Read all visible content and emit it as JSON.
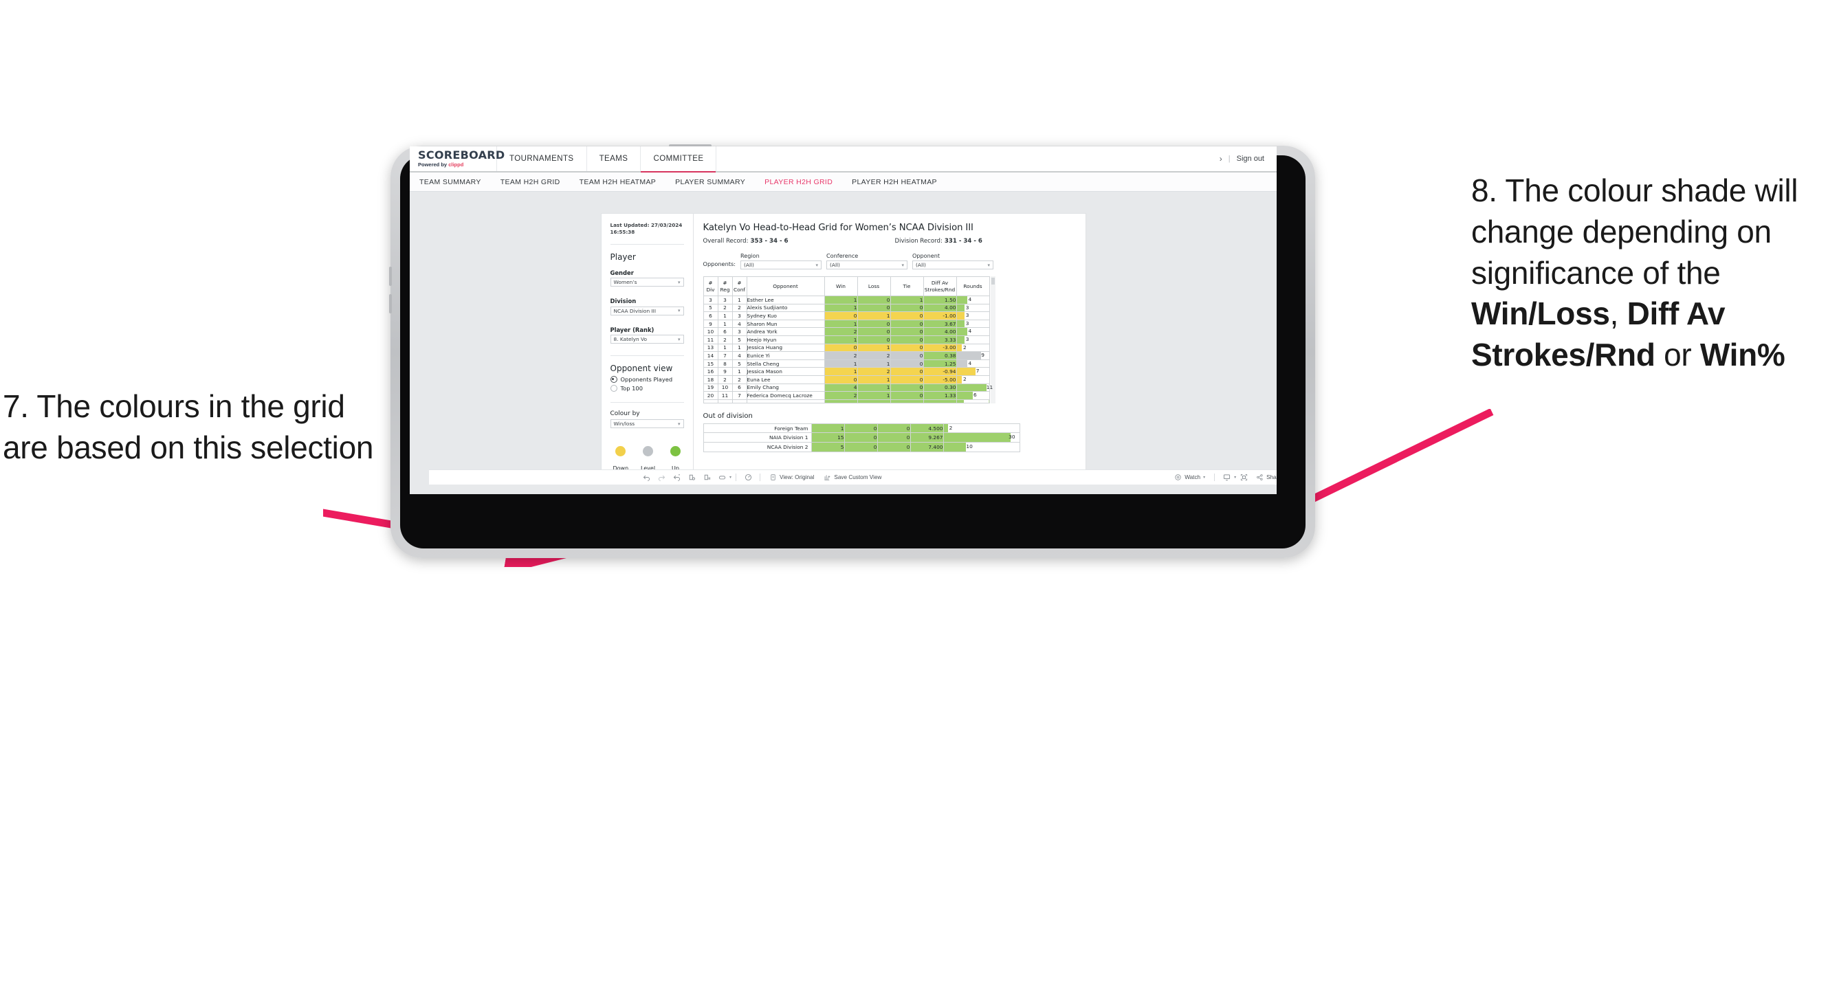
{
  "annotations": {
    "left": {
      "id": "7.",
      "text": "7. The colours in the grid are based on this selection"
    },
    "right": {
      "id": "8.",
      "line1": "8. The colour shade will change depending on significance of the ",
      "bold1": "Win/Loss",
      "mid1": ", ",
      "bold2": "Diff Av Strokes/Rnd",
      "mid2": " or ",
      "bold3": "Win%"
    },
    "arrow_color": "#EC1C5E"
  },
  "header": {
    "logo_word": "SCOREBOARD",
    "logo_powered": "Powered by ",
    "logo_brand": "clippd",
    "nav": [
      {
        "label": "TOURNAMENTS",
        "active": false
      },
      {
        "label": "TEAMS",
        "active": false
      },
      {
        "label": "COMMITTEE",
        "active": true
      }
    ],
    "chevron_icon": "›",
    "separator": "|",
    "sign_out": "Sign out"
  },
  "subnav": {
    "items": [
      {
        "label": "TEAM SUMMARY",
        "active": false
      },
      {
        "label": "TEAM H2H GRID",
        "active": false
      },
      {
        "label": "TEAM H2H HEATMAP",
        "active": false
      },
      {
        "label": "PLAYER SUMMARY",
        "active": false
      },
      {
        "label": "PLAYER H2H GRID",
        "active": true
      },
      {
        "label": "PLAYER H2H HEATMAP",
        "active": false
      }
    ],
    "active_color": "#E8386A"
  },
  "sidebar": {
    "last_updated_l1": "Last Updated: 27/03/2024",
    "last_updated_l2": "16:55:38",
    "player_heading": "Player",
    "fields": [
      {
        "label": "Gender",
        "value": "Women’s"
      },
      {
        "label": "Division",
        "value": "NCAA Division III"
      },
      {
        "label": "Player (Rank)",
        "value": "8. Katelyn Vo"
      }
    ],
    "opponent_view": {
      "heading": "Opponent view",
      "options": [
        {
          "label": "Opponents Played",
          "selected": true
        },
        {
          "label": "Top 100",
          "selected": false
        }
      ]
    },
    "colour_by": {
      "label": "Colour by",
      "value": "Win/loss"
    },
    "legend": [
      {
        "label": "Down",
        "color": "#F2D04B"
      },
      {
        "label": "Level",
        "color": "#BFC3C7"
      },
      {
        "label": "Up",
        "color": "#7DC242"
      }
    ],
    "caret_icon": "▾"
  },
  "main": {
    "title": "Katelyn Vo Head-to-Head Grid for Women’s NCAA Division III",
    "overall_record_label": "Overall Record:",
    "overall_record_value": "353 -  34 - 6",
    "division_record_label": "Division Record:",
    "division_record_value": "331 -  34 - 6",
    "opponents_label": "Opponents:",
    "filters": [
      {
        "label": "Region",
        "value": "(All)"
      },
      {
        "label": "Conference",
        "value": "(All)"
      },
      {
        "label": "Opponent",
        "value": "(All)"
      }
    ]
  },
  "chart_data": {
    "type": "table",
    "title": "Katelyn Vo Head-to-Head Grid for Women’s NCAA Division III",
    "columns": [
      "# Div",
      "# Reg",
      "# Conf",
      "Opponent",
      "Win",
      "Loss",
      "Tie",
      "Diff Av Strokes/Rnd",
      "Rounds"
    ],
    "column_headers_split": [
      {
        "l1": "#",
        "l2": "Div"
      },
      {
        "l1": "#",
        "l2": "Reg"
      },
      {
        "l1": "#",
        "l2": "Conf"
      },
      {
        "l1": "",
        "l2": "Opponent"
      },
      {
        "l1": "",
        "l2": "Win"
      },
      {
        "l1": "",
        "l2": "Loss"
      },
      {
        "l1": "",
        "l2": "Tie"
      },
      {
        "l1": "Diff Av",
        "l2": "Strokes/Rnd"
      },
      {
        "l1": "",
        "l2": "Rounds"
      }
    ],
    "rounds_max": 12,
    "colors": {
      "up": "#9ED06C",
      "down": "#F4D44F",
      "level": "#C9CCCF"
    },
    "rows": [
      {
        "div": "3",
        "reg": "3",
        "conf": "1",
        "opponent": "Esther Lee",
        "win": "1",
        "loss": "0",
        "tie": "1",
        "diff": "1.50",
        "rounds": "4",
        "rounds_val": 4,
        "status": "up"
      },
      {
        "div": "5",
        "reg": "2",
        "conf": "2",
        "opponent": "Alexis Sudjianto",
        "win": "1",
        "loss": "0",
        "tie": "0",
        "diff": "4.00",
        "rounds": "3",
        "rounds_val": 3,
        "status": "up"
      },
      {
        "div": "6",
        "reg": "1",
        "conf": "3",
        "opponent": "Sydney Kuo",
        "win": "0",
        "loss": "1",
        "tie": "0",
        "diff": "-1.00",
        "rounds": "3",
        "rounds_val": 3,
        "status": "down"
      },
      {
        "div": "9",
        "reg": "1",
        "conf": "4",
        "opponent": "Sharon Mun",
        "win": "1",
        "loss": "0",
        "tie": "0",
        "diff": "3.67",
        "rounds": "3",
        "rounds_val": 3,
        "status": "up"
      },
      {
        "div": "10",
        "reg": "6",
        "conf": "3",
        "opponent": "Andrea York",
        "win": "2",
        "loss": "0",
        "tie": "0",
        "diff": "4.00",
        "rounds": "4",
        "rounds_val": 4,
        "status": "up"
      },
      {
        "div": "11",
        "reg": "2",
        "conf": "5",
        "opponent": "Heejo Hyun",
        "win": "1",
        "loss": "0",
        "tie": "0",
        "diff": "3.33",
        "rounds": "3",
        "rounds_val": 3,
        "status": "up"
      },
      {
        "div": "13",
        "reg": "1",
        "conf": "1",
        "opponent": "Jessica Huang",
        "win": "0",
        "loss": "1",
        "tie": "0",
        "diff": "-3.00",
        "rounds": "2",
        "rounds_val": 2,
        "status": "down"
      },
      {
        "div": "14",
        "reg": "7",
        "conf": "4",
        "opponent": "Eunice Yi",
        "win": "2",
        "loss": "2",
        "tie": "0",
        "diff": "0.38",
        "rounds": "9",
        "rounds_val": 9,
        "status": "level",
        "diff_status": "up"
      },
      {
        "div": "15",
        "reg": "8",
        "conf": "5",
        "opponent": "Stella Cheng",
        "win": "1",
        "loss": "1",
        "tie": "0",
        "diff": "1.25",
        "rounds": "4",
        "rounds_val": 4,
        "status": "level",
        "diff_status": "up"
      },
      {
        "div": "16",
        "reg": "9",
        "conf": "1",
        "opponent": "Jessica Mason",
        "win": "1",
        "loss": "2",
        "tie": "0",
        "diff": "-0.94",
        "rounds": "7",
        "rounds_val": 7,
        "status": "down"
      },
      {
        "div": "18",
        "reg": "2",
        "conf": "2",
        "opponent": "Euna Lee",
        "win": "0",
        "loss": "1",
        "tie": "0",
        "diff": "-5.00",
        "rounds": "2",
        "rounds_val": 2,
        "status": "down"
      },
      {
        "div": "19",
        "reg": "10",
        "conf": "6",
        "opponent": "Emily Chang",
        "win": "4",
        "loss": "1",
        "tie": "0",
        "diff": "0.30",
        "rounds": "11",
        "rounds_val": 11,
        "status": "up"
      },
      {
        "div": "20",
        "reg": "11",
        "conf": "7",
        "opponent": "Federica Domecq Lacroze",
        "win": "2",
        "loss": "1",
        "tie": "0",
        "diff": "1.33",
        "rounds": "6",
        "rounds_val": 6,
        "status": "up"
      }
    ]
  },
  "out_of_division": {
    "title": "Out of division",
    "rounds_max": 34,
    "rows": [
      {
        "name": "Foreign Team",
        "win": "1",
        "loss": "0",
        "tie": "0",
        "diff": "4.500",
        "rounds": "2",
        "rounds_val": 2,
        "status": "up"
      },
      {
        "name": "NAIA Division 1",
        "win": "15",
        "loss": "0",
        "tie": "0",
        "diff": "9.267",
        "rounds": "30",
        "rounds_val": 30,
        "status": "up"
      },
      {
        "name": "NCAA Division 2",
        "win": "5",
        "loss": "0",
        "tie": "0",
        "diff": "7.400",
        "rounds": "10",
        "rounds_val": 10,
        "status": "up"
      }
    ]
  },
  "toolbar": {
    "icons": [
      {
        "name": "undo-icon",
        "glyph": "↶"
      },
      {
        "name": "redo-icon",
        "glyph": "↷"
      },
      {
        "name": "revert-icon",
        "glyph": "↺"
      },
      {
        "name": "refresh-data-icon",
        "glyph": "⛁"
      },
      {
        "name": "pause-updates-icon",
        "glyph": "⛁"
      },
      {
        "name": "device-layout-icon",
        "glyph": "▭"
      }
    ],
    "layout_caret": "▾",
    "alerts_icon": "◴",
    "view_original": {
      "icon": "view-original-icon",
      "label": "View: Original"
    },
    "save_custom_view": {
      "icon": "save-view-icon",
      "label": "Save Custom View"
    },
    "watch": {
      "icon": "watch-icon",
      "label": "Watch",
      "caret": "▾"
    },
    "download": {
      "icon": "download-icon",
      "caret": "▾"
    },
    "fullscreen": {
      "icon": "fullscreen-icon"
    },
    "share": {
      "icon": "share-icon",
      "label": "Share"
    }
  }
}
